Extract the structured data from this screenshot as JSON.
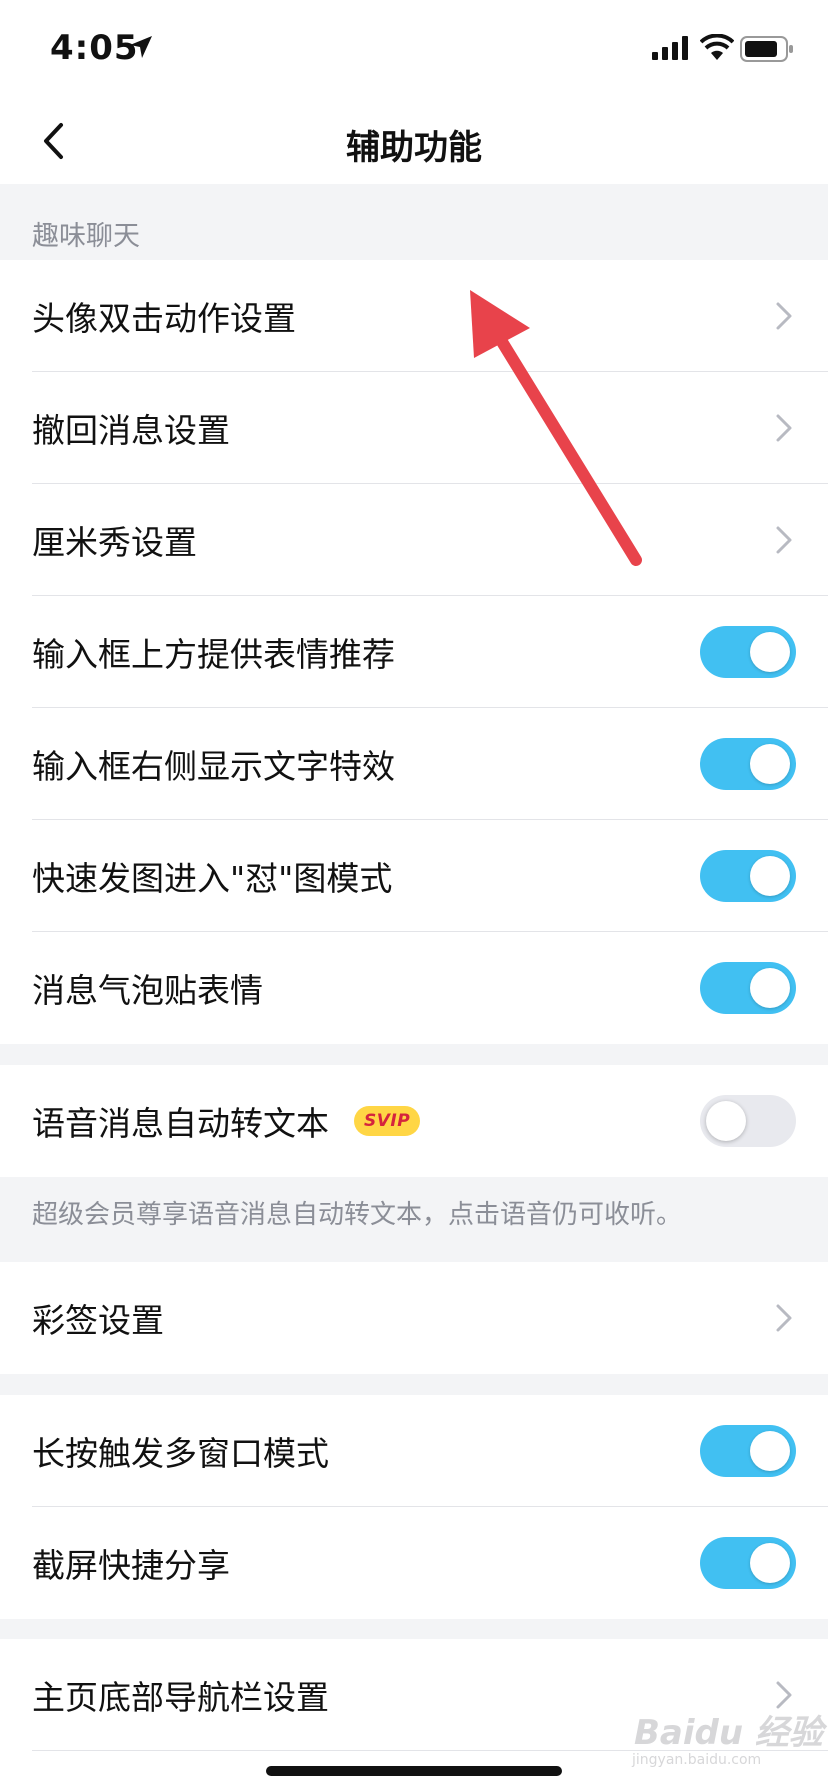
{
  "status_bar": {
    "time": "4:05"
  },
  "nav": {
    "title": "辅助功能"
  },
  "section_fun_chat": {
    "header": "趣味聊天"
  },
  "rows": [
    {
      "label": "头像双击动作设置",
      "control": "chevron"
    },
    {
      "label": "撤回消息设置",
      "control": "chevron"
    },
    {
      "label": "厘米秀设置",
      "control": "chevron"
    },
    {
      "label": "输入框上方提供表情推荐",
      "control": "toggle",
      "on": true
    },
    {
      "label": "输入框右侧显示文字特效",
      "control": "toggle",
      "on": true
    },
    {
      "label": "快速发图进入\"怼\"图模式",
      "control": "toggle",
      "on": true
    },
    {
      "label": "消息气泡贴表情",
      "control": "toggle",
      "on": true
    },
    {
      "label": "语音消息自动转文本",
      "badge": "SVIP",
      "control": "toggle",
      "on": false
    },
    {
      "label": "彩签设置",
      "control": "chevron"
    },
    {
      "label": "长按触发多窗口模式",
      "control": "toggle",
      "on": true
    },
    {
      "label": "截屏快捷分享",
      "control": "toggle",
      "on": true
    },
    {
      "label": "主页底部导航栏设置",
      "control": "chevron"
    }
  ],
  "voice_note": "超级会员尊享语音消息自动转文本，点击语音仍可收听。",
  "colors": {
    "toggle_on": "#41c0f2",
    "toggle_off": "#e8e9ee",
    "annotation_arrow": "#e8434b"
  },
  "watermark": {
    "brand": "Baidu 经验",
    "url": "jingyan.baidu.com"
  }
}
